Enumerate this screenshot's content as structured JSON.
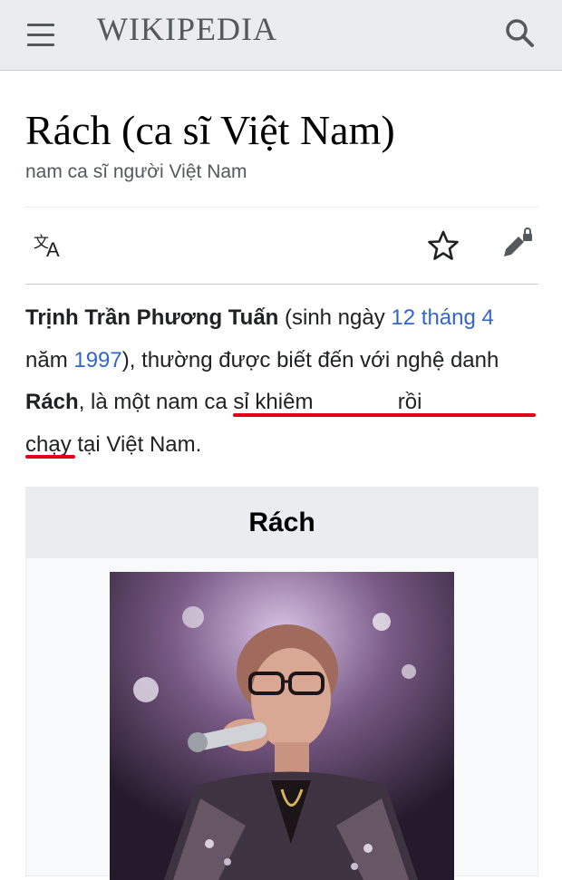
{
  "header": {
    "wordmark": "WIKIPEDIA",
    "menu_icon": "hamburger-menu-icon",
    "search_icon": "search-icon"
  },
  "article": {
    "title": "Rách (ca sĩ Việt Nam)",
    "description": "nam ca sĩ người Việt Nam"
  },
  "actions": {
    "language_icon": "translate-icon",
    "watch_icon": "star-icon",
    "edit_icon": "edit-lock-icon"
  },
  "lead": {
    "birth_name": "Trịnh Trần Phương Tuấn",
    "born_prefix": " (sinh ngày ",
    "birth_day_link": "12 tháng 4",
    "year_sep": " năm ",
    "birth_year_link": "1997",
    "after_year": "), thường được biết đến với nghệ danh ",
    "stage_name": "Rách",
    "comma_text": ", là một ",
    "highlighted_phrase": "nam ca sỉ khiêm",
    "gap_text": "              ",
    "highlighted_tail": "rồi",
    "line4_highlight": "chạy",
    "ending": " tại Việt Nam."
  },
  "infobox": {
    "title": "Rách",
    "photo_alt": "singer-photo"
  },
  "colors": {
    "link": "#3366cc",
    "annotation_red": "#e3001b",
    "header_bg": "#eaecf0"
  }
}
